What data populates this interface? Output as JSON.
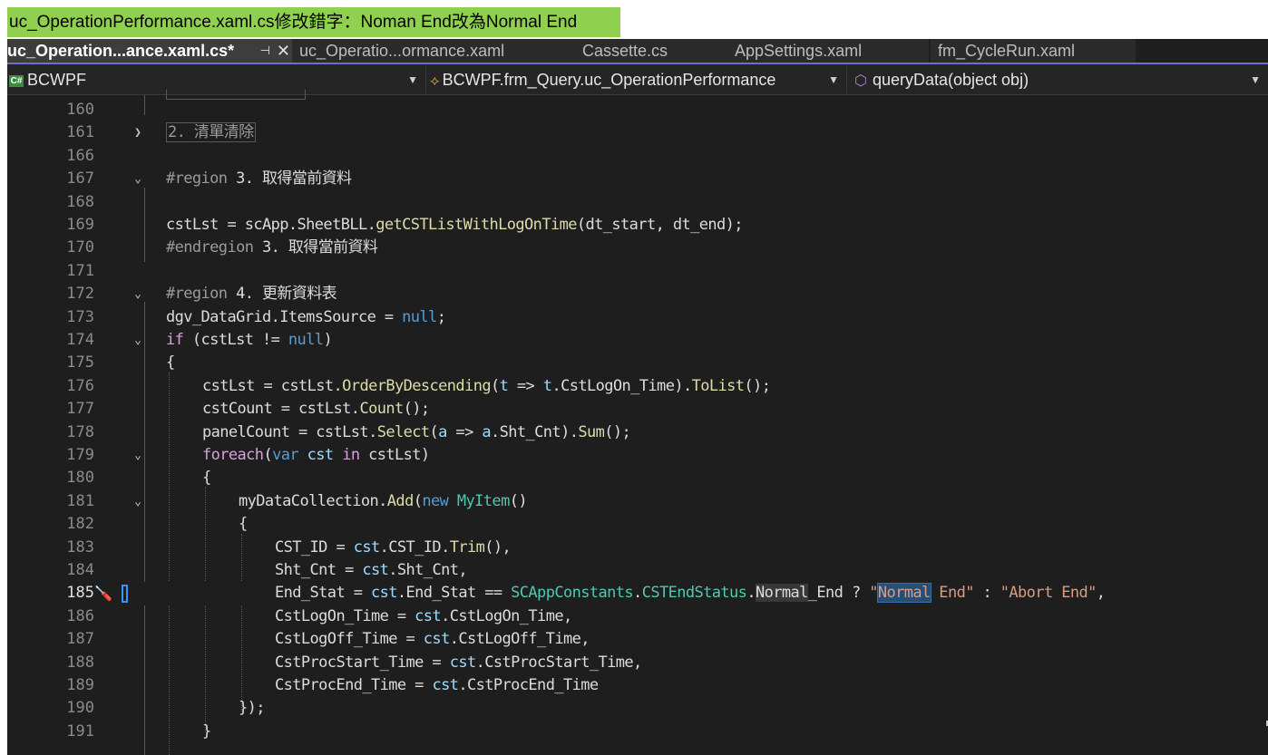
{
  "banner": "uc_OperationPerformance.xaml.cs修改錯字：Noman End改為Normal End",
  "tabs": [
    {
      "label": "uc_Operation...ance.xaml.cs*",
      "active": true
    },
    {
      "label": "uc_Operatio...ormance.xaml",
      "active": false
    },
    {
      "label": "Cassette.cs",
      "active": false
    },
    {
      "label": "AppSettings.xaml",
      "active": false
    },
    {
      "label": "fm_CycleRun.xaml",
      "active": false
    }
  ],
  "navbar": {
    "project": "BCWPF",
    "class": "BCWPF.frm_Query.uc_OperationPerformance",
    "member": "queryData(object obj)"
  },
  "icons": {
    "pin": "pin-icon",
    "close": "close-icon",
    "csharp": "csharp-file-icon",
    "class": "class-icon",
    "method": "method-cube-icon",
    "quick_action": "screwdriver-icon"
  },
  "colors": {
    "banner": "#8fd14f",
    "editor_bg": "#1e1e1e",
    "keyword": "#569cd6",
    "type": "#4ec9b0",
    "string": "#d69d85",
    "method": "#dcdcaa"
  },
  "line_numbers": [
    "160",
    "161",
    "166",
    "167",
    "168",
    "169",
    "170",
    "171",
    "172",
    "173",
    "174",
    "175",
    "176",
    "177",
    "178",
    "179",
    "180",
    "181",
    "182",
    "183",
    "184",
    "185",
    "186",
    "187",
    "188",
    "189",
    "190",
    "191"
  ],
  "code": {
    "l161": "2. 清單清除",
    "l167_kw": "#region",
    "l167_txt": " 3. 取得當前資料",
    "l169_a": "cstLst = scApp.SheetBLL.",
    "l169_m": "getCSTListWithLogOnTime",
    "l169_b": "(dt_start, dt_end);",
    "l170_kw": "#endregion",
    "l170_txt": " 3. 取得當前資料",
    "l172_kw": "#region",
    "l172_txt": " 4. 更新資料表",
    "l173_a": "dgv_DataGrid.ItemsSource = ",
    "l173_k": "null",
    "l173_b": ";",
    "l174_if": "if",
    "l174_a": " (cstLst != ",
    "l174_k": "null",
    "l174_b": ")",
    "l175": "{",
    "l176_a": "cstLst = cstLst.",
    "l176_m1": "OrderByDescending",
    "l176_b": "(",
    "l176_p1": "t",
    "l176_c": " => ",
    "l176_p2": "t",
    "l176_d": ".CstLogOn_Time).",
    "l176_m2": "ToList",
    "l176_e": "();",
    "l177_a": "cstCount = cstLst.",
    "l177_m": "Count",
    "l177_b": "();",
    "l178_a": "panelCount = cstLst.",
    "l178_m1": "Select",
    "l178_b": "(",
    "l178_p1": "a",
    "l178_c": " => ",
    "l178_p2": "a",
    "l178_d": ".Sht_Cnt).",
    "l178_m2": "Sum",
    "l178_e": "();",
    "l179_fe": "foreach",
    "l179_a": "(",
    "l179_var": "var",
    "l179_b": " ",
    "l179_cst": "cst",
    "l179_c": " ",
    "l179_in": "in",
    "l179_d": " cstLst)",
    "l180": "{",
    "l181_a": "myDataCollection.",
    "l181_m": "Add",
    "l181_b": "(",
    "l181_new": "new",
    "l181_c": " ",
    "l181_t": "MyItem",
    "l181_d": "()",
    "l182": "{",
    "l183_a": "CST_ID = ",
    "l183_cst": "cst",
    "l183_b": ".CST_ID.",
    "l183_m": "Trim",
    "l183_c": "(),",
    "l184_a": "Sht_Cnt = ",
    "l184_cst": "cst",
    "l184_b": ".Sht_Cnt,",
    "l185_a": "End_Stat = ",
    "l185_cst": "cst",
    "l185_b": ".End_Stat == ",
    "l185_t": "SCAppConstants",
    "l185_c": ".",
    "l185_t2": "CSTEndStatus",
    "l185_d": ".",
    "l185_ref": "Normal",
    "l185_e": "_End ? ",
    "l185_q1": "\"",
    "l185_sel": "Normal",
    "l185_s1": " End\"",
    "l185_f": " : ",
    "l185_s2": "\"Abort End\"",
    "l185_g": ",",
    "l186_a": "CstLogOn_Time = ",
    "l186_cst": "cst",
    "l186_b": ".CstLogOn_Time,",
    "l187_a": "CstLogOff_Time = ",
    "l187_cst": "cst",
    "l187_b": ".CstLogOff_Time,",
    "l188_a": "CstProcStart_Time = ",
    "l188_cst": "cst",
    "l188_b": ".CstProcStart_Time,",
    "l189_a": "CstProcEnd_Time = ",
    "l189_cst": "cst",
    "l189_b": ".CstProcEnd_Time",
    "l190": "});",
    "l191": "}"
  }
}
